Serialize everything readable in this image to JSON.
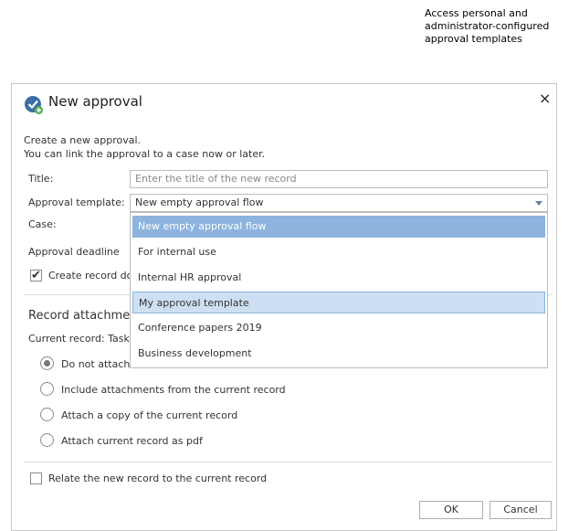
{
  "callout": {
    "line1": "Access personal and",
    "line2": "administrator-configured",
    "line3": "approval templates"
  },
  "dialog": {
    "title": "New approval",
    "close_symbol": "×",
    "intro_line1": "Create a new approval.",
    "intro_line2": "You can link the approval to a case now or later."
  },
  "form": {
    "title_label": "Title:",
    "title_placeholder": "Enter the title of the new record",
    "template_label": "Approval template:",
    "template_value": "New empty approval flow",
    "case_label": "Case:",
    "deadline_label": "Approval deadline",
    "create_record_label": "Create record do"
  },
  "dropdown": {
    "options": [
      "New empty approval flow",
      "For internal use",
      "Internal HR approval",
      "My approval template",
      "Conference papers 2019",
      "Business development"
    ]
  },
  "attachments": {
    "heading": "Record attachmen",
    "current_record_label": "Current record: Tasks",
    "options": [
      "Do not attach",
      "Include attachments from the current record",
      "Attach a copy of the current record",
      "Attach current record as pdf"
    ]
  },
  "relate_label": "Relate the new record to the current record",
  "buttons": {
    "ok": "OK",
    "cancel": "Cancel"
  },
  "colors": {
    "accent": "#8cb4de",
    "hover": "#cde0f3",
    "icon": "#3b6ea5"
  }
}
